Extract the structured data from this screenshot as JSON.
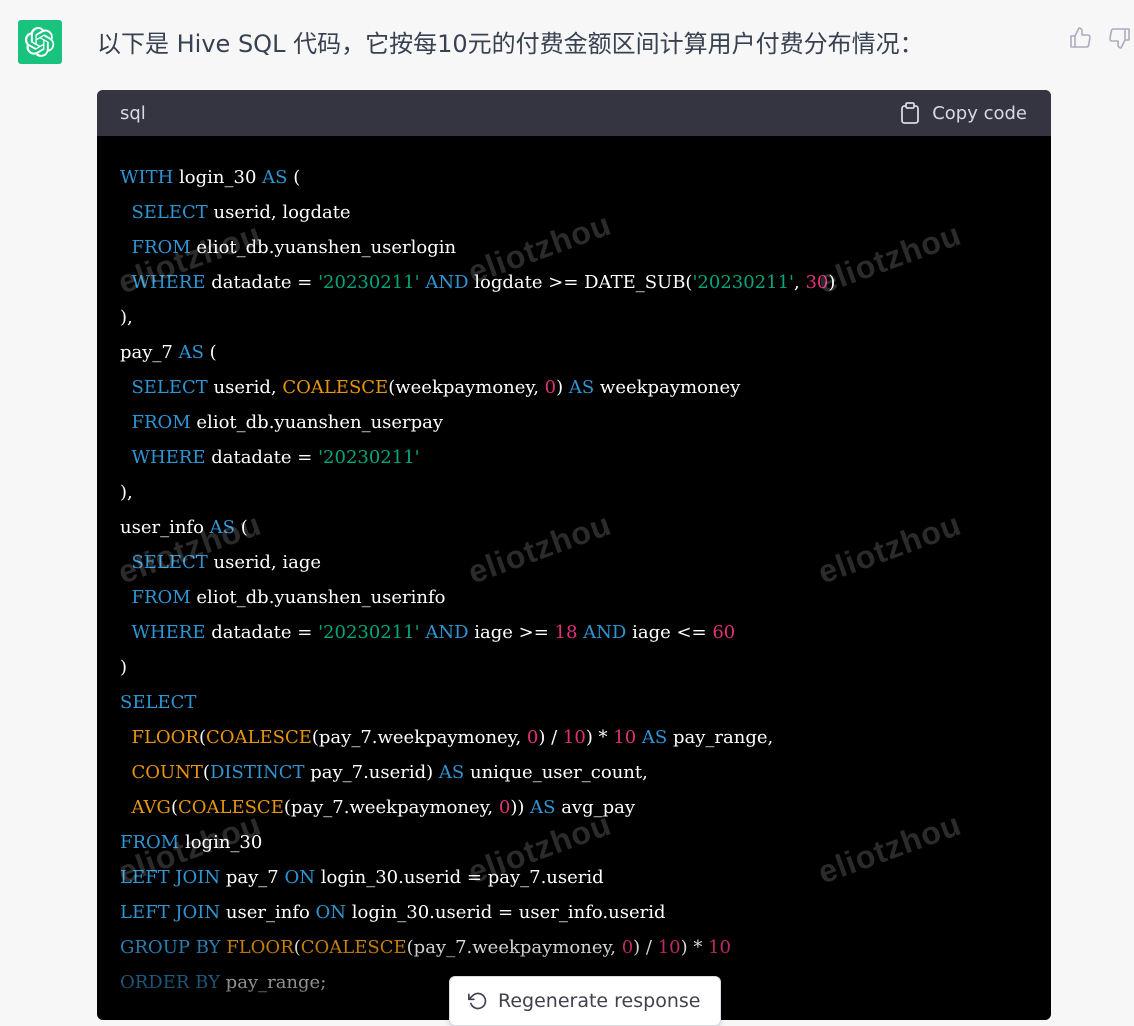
{
  "message": {
    "intro": "以下是 Hive SQL 代码，它按每10元的付费金额区间计算用户付费分布情况："
  },
  "code_block": {
    "language": "sql",
    "copy_label": "Copy code"
  },
  "watermark": "eliotzhou",
  "regenerate_label": "Regenerate response",
  "icons": [
    "openai-logo-icon",
    "thumbs-up-icon",
    "thumbs-down-icon",
    "clipboard-icon",
    "refresh-icon"
  ],
  "colors": {
    "avatar": "#19c37d",
    "code_bg": "#000000",
    "header_bg": "#343541",
    "keyword": "#2e95d3",
    "function": "#f22c3d",
    "builtin": "#e9950c",
    "string": "#00a67d",
    "number": "#df3079"
  }
}
